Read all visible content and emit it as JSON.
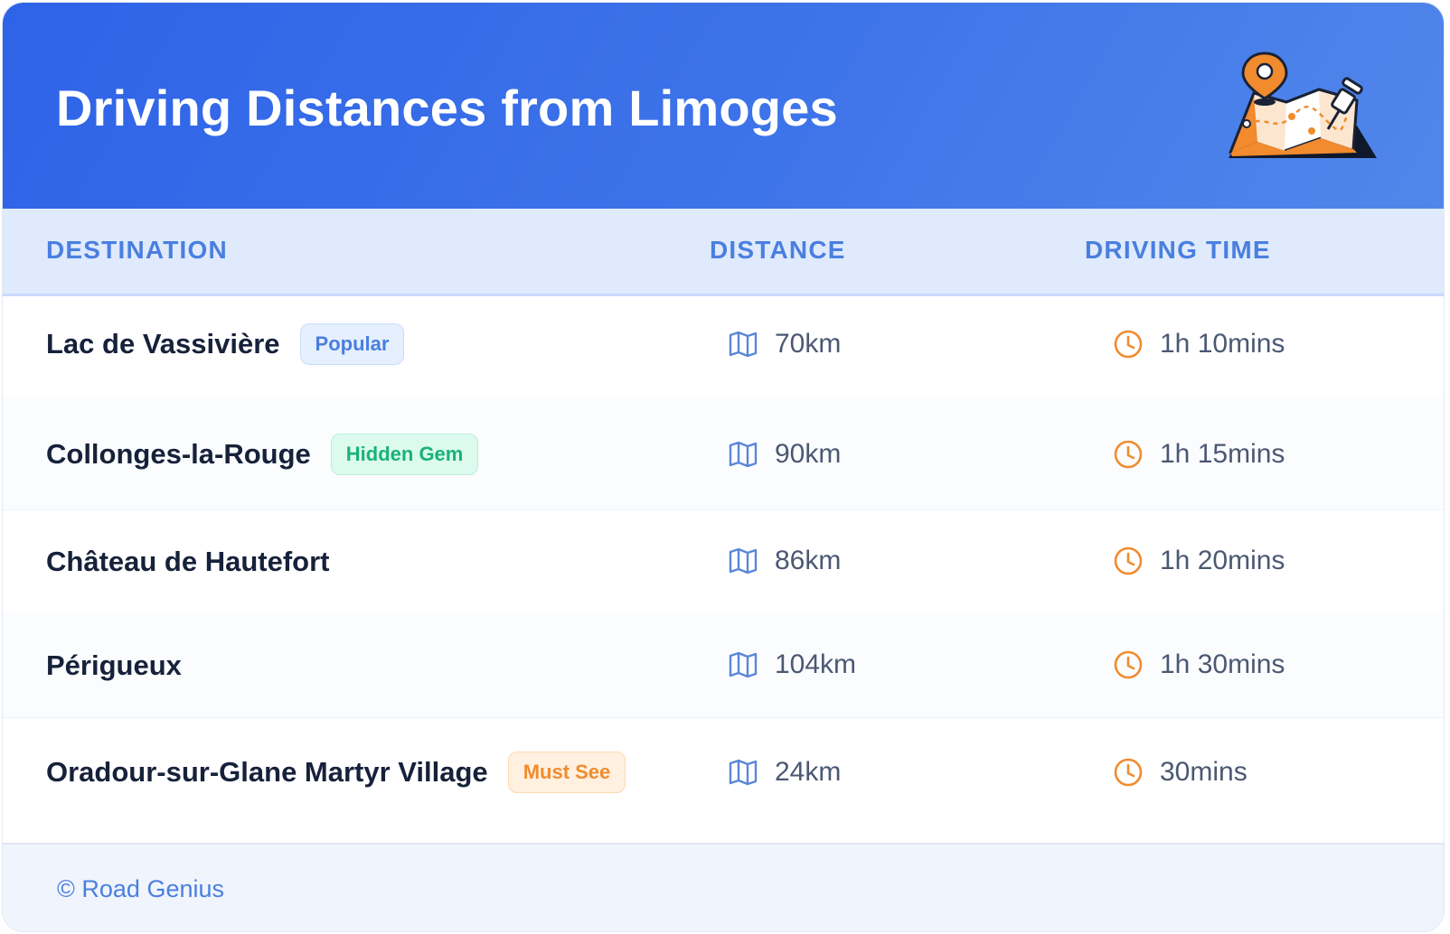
{
  "header": {
    "title": "Driving Distances from Limoges",
    "illustration_icon": "map-with-pins-icon"
  },
  "table": {
    "columns": [
      "DESTINATION",
      "DISTANCE",
      "DRIVING TIME"
    ],
    "rows": [
      {
        "destination": "Lac de Vassivière",
        "badge": "Popular",
        "badge_type": "popular",
        "distance": "70km",
        "time": "1h 10mins"
      },
      {
        "destination": "Collonges-la-Rouge",
        "badge": "Hidden Gem",
        "badge_type": "gem",
        "distance": "90km",
        "time": "1h 15mins"
      },
      {
        "destination": "Château de Hautefort",
        "badge": "",
        "badge_type": "",
        "distance": "86km",
        "time": "1h 20mins"
      },
      {
        "destination": "Périgueux",
        "badge": "",
        "badge_type": "",
        "distance": "104km",
        "time": "1h 30mins"
      },
      {
        "destination": "Oradour-sur-Glane Martyr Village",
        "badge": "Must See",
        "badge_type": "must",
        "distance": "24km",
        "time": "30mins"
      }
    ],
    "distance_icon": "map-icon",
    "time_icon": "clock-icon"
  },
  "footer": {
    "brand": "© Road Genius"
  },
  "colors": {
    "header_start": "#2e63e7",
    "header_end": "#5187ea",
    "accent_blue": "#4a7fdf",
    "accent_orange": "#f08c2e",
    "accent_green": "#19b27a",
    "text_dark": "#16213a"
  }
}
